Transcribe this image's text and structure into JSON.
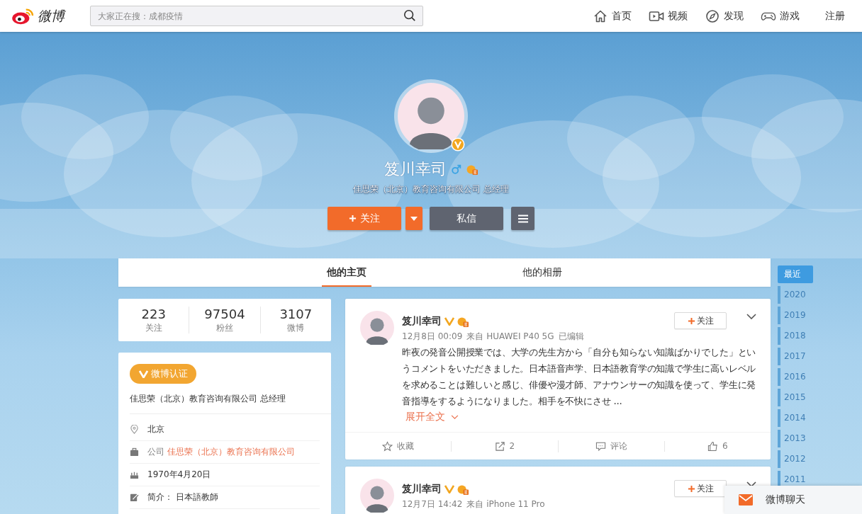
{
  "header": {
    "logo_text": "微博",
    "search": {
      "placeholder": "大家正在搜：成都疫情"
    },
    "nav": [
      {
        "kind": "home",
        "label": "首页"
      },
      {
        "kind": "video",
        "label": "视频"
      },
      {
        "kind": "compass",
        "label": "发现"
      },
      {
        "kind": "game",
        "label": "游戏"
      },
      {
        "kind": "plain",
        "label": "注册"
      }
    ]
  },
  "profile": {
    "name": "笈川幸司",
    "verified": true,
    "male": true,
    "subtitle": "佳思荣（北京）教育咨询有限公司 总经理",
    "follow_label": "关注",
    "message_label": "私信"
  },
  "tabs": [
    {
      "label": "他的主页",
      "selected": true
    },
    {
      "label": "他的相册",
      "selected": false
    }
  ],
  "stats": [
    {
      "value": "223",
      "label": "关注"
    },
    {
      "value": "97504",
      "label": "粉丝"
    },
    {
      "value": "3107",
      "label": "微博"
    }
  ],
  "info": {
    "badge": "微博认证",
    "title": "佳思荣（北京）教育咨询有限公司 总经理",
    "rows": [
      {
        "kind": "location",
        "text": "北京"
      },
      {
        "kind": "company",
        "label": "公司",
        "link": "佳思荣（北京）教育咨询有限公司"
      },
      {
        "kind": "birthday",
        "text": "1970年4月20日"
      },
      {
        "kind": "bio",
        "text": "简介： 日本語教師"
      }
    ]
  },
  "posts": [
    {
      "author": "笈川幸司",
      "time": "12月8日 00:09",
      "source": "来自 HUAWEI P40 5G",
      "edited": "已编辑",
      "follow_label": "关注",
      "text": "昨夜の発音公開授業では、大学の先生方から「自分も知らない知識ばかりでした」というコメントをいただきました。日本語音声学、日本語教育学の知識で学生に高いレベルを求めることは難しいと感じ、俳優や漫才師、アナウンサーの知識を使って、学生に発音指導をするようになりました。相手を不快にさせ ...",
      "expand": "展开全文",
      "actions": [
        {
          "kind": "favorite",
          "label": "收藏"
        },
        {
          "kind": "repost",
          "label": "2"
        },
        {
          "kind": "comment",
          "label": "评论"
        },
        {
          "kind": "like",
          "label": "6"
        }
      ]
    },
    {
      "author": "笈川幸司",
      "time": "12月7日 14:42",
      "source": "来自 iPhone 11 Pro",
      "follow_label": "关注"
    }
  ],
  "timeline": [
    {
      "label": "最近",
      "selected": true
    },
    {
      "label": "2020",
      "selected": false
    },
    {
      "label": "2019",
      "selected": false
    },
    {
      "label": "2018",
      "selected": false
    },
    {
      "label": "2017",
      "selected": false
    },
    {
      "label": "2016",
      "selected": false
    },
    {
      "label": "2015",
      "selected": false
    },
    {
      "label": "2014",
      "selected": false
    },
    {
      "label": "2013",
      "selected": false
    },
    {
      "label": "2012",
      "selected": false
    },
    {
      "label": "2011",
      "selected": false
    }
  ],
  "chat": {
    "label": "微博聊天"
  }
}
